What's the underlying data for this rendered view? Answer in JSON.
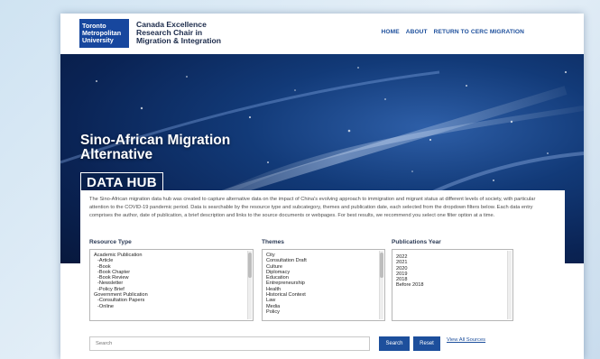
{
  "header": {
    "logo_lines": [
      "Toronto",
      "Metropolitan",
      "University"
    ],
    "site_title_lines": [
      "Canada Excellence",
      "Research Chair in",
      "Migration & Integration"
    ],
    "nav": [
      "HOME",
      "ABOUT",
      "RETURN TO CERC MIGRATION"
    ]
  },
  "hero": {
    "title_lines": [
      "Sino-African Migration",
      "Alternative"
    ],
    "badge": "DATA HUB"
  },
  "intro": "The Sino-African migration data hub was created to capture alternative data on the impact of China's evolving approach to immigration and migrant status at different levels of society, with particular attention to the COVID-19 pandemic period. Data is searchable by the resource type and subcategory, themes and publication date, each selected from the dropdown filters below. Each data entry comprises the author, date of publication, a brief description and links to the source documents or webpages. For best results, we recommend you select one filter option at a time.",
  "filters": {
    "resource_type": {
      "label": "Resource Type",
      "options": [
        "Academic Publication",
        " -Article",
        " -Book",
        " -Book Chapter",
        " -Book Review",
        " -Newsletter",
        " -Policy Brief",
        "Government Publication",
        " -Consultation Papers",
        " -Online"
      ]
    },
    "themes": {
      "label": "Themes",
      "options": [
        "City",
        "Consultation Draft",
        "Culture",
        "Diplomacy",
        "Education",
        "Entrepreneurship",
        "Health",
        "Historical Context",
        "Law",
        "Media",
        "Policy"
      ]
    },
    "publications_year": {
      "label": "Publications Year",
      "options": [
        "2022",
        "2021",
        "2020",
        "2019",
        "2018",
        "Before 2018"
      ]
    }
  },
  "search": {
    "placeholder": "Search",
    "search_label": "Search",
    "reset_label": "Reset",
    "view_all_label": "View All Sources"
  },
  "colors": {
    "brand_blue": "#1d4f9c",
    "logo_blue": "#17479e",
    "hero_dark": "#0a2354"
  }
}
